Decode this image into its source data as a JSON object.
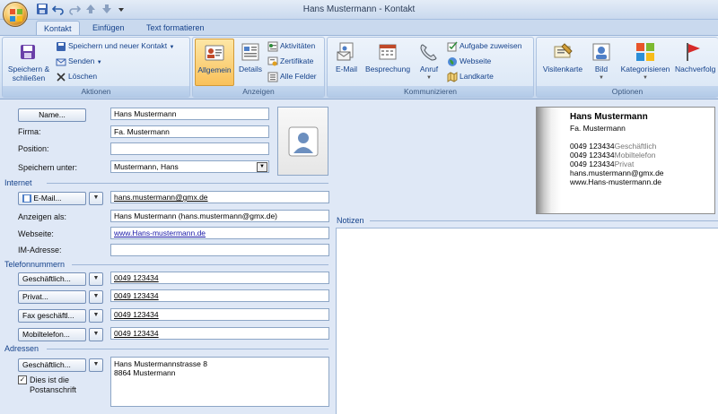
{
  "window": {
    "title": "Hans Mustermann - Kontakt"
  },
  "tabs": [
    {
      "label": "Kontakt",
      "active": true
    },
    {
      "label": "Einfügen",
      "active": false
    },
    {
      "label": "Text formatieren",
      "active": false
    }
  ],
  "ribbon": {
    "aktionen": {
      "label": "Aktionen",
      "save_close": "Speichern & schließen",
      "save_new": "Speichern und neuer Kontakt",
      "send": "Senden",
      "delete": "Löschen"
    },
    "anzeigen": {
      "label": "Anzeigen",
      "allgemein": "Allgemein",
      "details": "Details",
      "aktivitaeten": "Aktivitäten",
      "zertifikate": "Zertifikate",
      "alle_felder": "Alle Felder"
    },
    "kommunizieren": {
      "label": "Kommunizieren",
      "email": "E-Mail",
      "besprechung": "Besprechung",
      "anruf": "Anruf",
      "aufgabe": "Aufgabe zuweisen",
      "webseite": "Webseite",
      "landkarte": "Landkarte"
    },
    "optionen": {
      "label": "Optionen",
      "visitenkarte": "Visitenkarte",
      "bild": "Bild",
      "kategorisieren": "Kategorisieren",
      "nachverfolgung": "Nachverfolg"
    }
  },
  "form": {
    "name_button": "Name...",
    "name_value": "Hans Mustermann",
    "firma_label": "Firma:",
    "firma_value": "Fa. Mustermann",
    "position_label": "Position:",
    "position_value": "",
    "speichern_unter_label": "Speichern unter:",
    "speichern_unter_value": "Mustermann, Hans",
    "internet_section": "Internet",
    "email_button": "E-Mail...",
    "email_value": "hans.mustermann@gmx.de",
    "anzeigen_als_label": "Anzeigen als:",
    "anzeigen_als_value": "Hans Mustermann (hans.mustermann@gmx.de)",
    "webseite_label": "Webseite:",
    "webseite_value": "www.Hans-mustermann.de",
    "im_label": "IM-Adresse:",
    "im_value": "",
    "telefon_section": "Telefonnummern",
    "phones": [
      {
        "button": "Geschäftlich...",
        "value": "0049 123434"
      },
      {
        "button": "Privat...",
        "value": "0049 123434"
      },
      {
        "button": "Fax geschäftl...",
        "value": "0049 123434"
      },
      {
        "button": "Mobiltelefon...",
        "value": "0049 123434"
      }
    ],
    "adressen_section": "Adressen",
    "address_button": "Geschäftlich...",
    "address_line1": "Hans Mustermannstrasse 8",
    "address_line2": "8864 Mustermann",
    "postanschrift_checked": true,
    "postanschrift_line1": "Dies ist die",
    "postanschrift_line2": "Postanschrift",
    "notizen_label": "Notizen"
  },
  "business_card": {
    "name": "Hans Mustermann",
    "company": "Fa. Mustermann",
    "phone1": "0049 123434",
    "phone1_type": "Geschäftlich",
    "phone2": "0049 123434",
    "phone2_type": "Mobiltelefon",
    "phone3": "0049 123434",
    "phone3_type": "Privat",
    "email": "hans.mustermann@gmx.de",
    "web": "www.Hans-mustermann.de"
  },
  "icons": [
    "office-button-icon",
    "save-icon",
    "undo-icon",
    "redo-icon",
    "arrow-up-icon",
    "arrow-down-icon",
    "qat-dropdown-icon",
    "contact-card-icon",
    "details-icon",
    "activities-icon",
    "certificate-icon",
    "all-fields-icon",
    "email-icon",
    "meeting-icon",
    "phone-icon",
    "task-icon",
    "globe-icon",
    "map-icon",
    "business-card-icon",
    "picture-icon",
    "categories-icon",
    "flag-icon",
    "contact-photo-icon"
  ]
}
